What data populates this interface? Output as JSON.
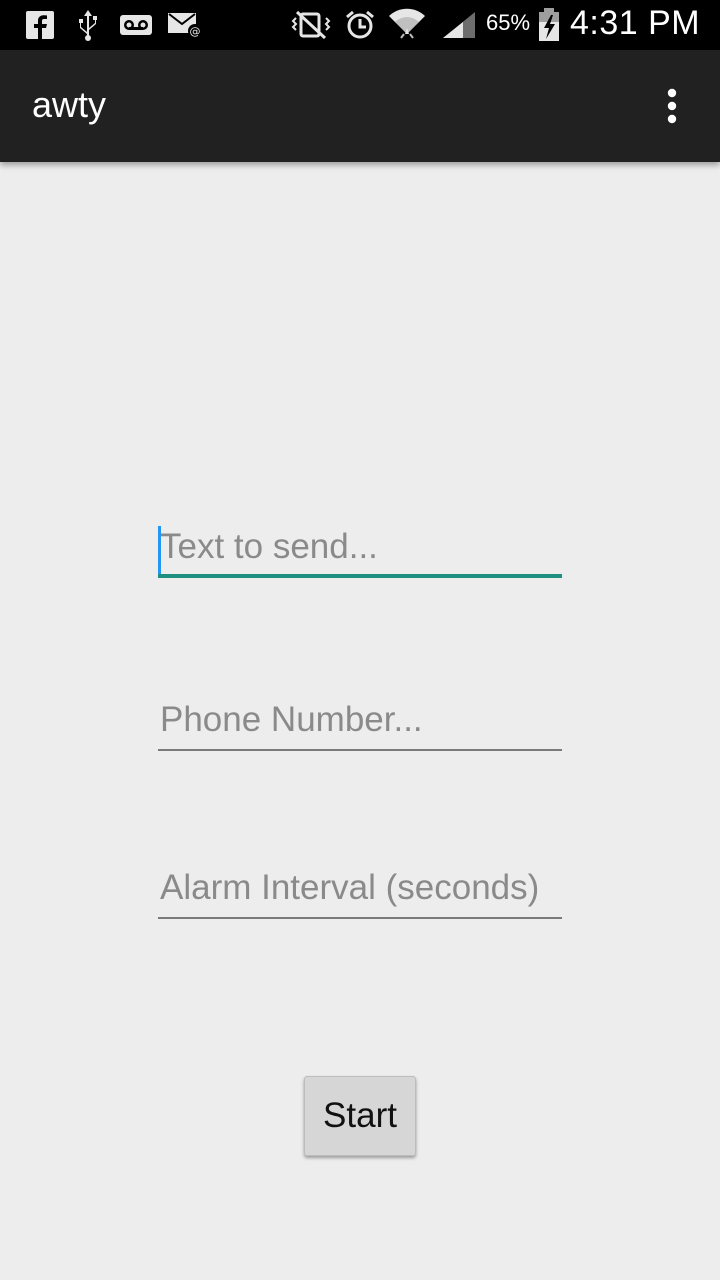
{
  "status_bar": {
    "left_icons": [
      "facebook-icon",
      "usb-icon",
      "voicemail-icon",
      "email-icon"
    ],
    "right_icons": [
      "vibrate-mute-icon",
      "alarm-icon",
      "wifi-icon",
      "signal-icon",
      "battery-charging-icon"
    ],
    "battery_percent": "65%",
    "time": "4:31 PM"
  },
  "action_bar": {
    "title": "awty",
    "overflow_icon": "overflow-menu-icon"
  },
  "form": {
    "text_field": {
      "value": "",
      "placeholder": "Text to send..."
    },
    "phone_field": {
      "value": "",
      "placeholder": "Phone Number..."
    },
    "interval_field": {
      "value": "",
      "placeholder": "Alarm Interval (seconds)"
    },
    "start_label": "Start"
  },
  "colors": {
    "action_bar": "#212121",
    "background": "#ededed",
    "focus_underline": "#1e9080",
    "cursor": "#2196f3"
  }
}
